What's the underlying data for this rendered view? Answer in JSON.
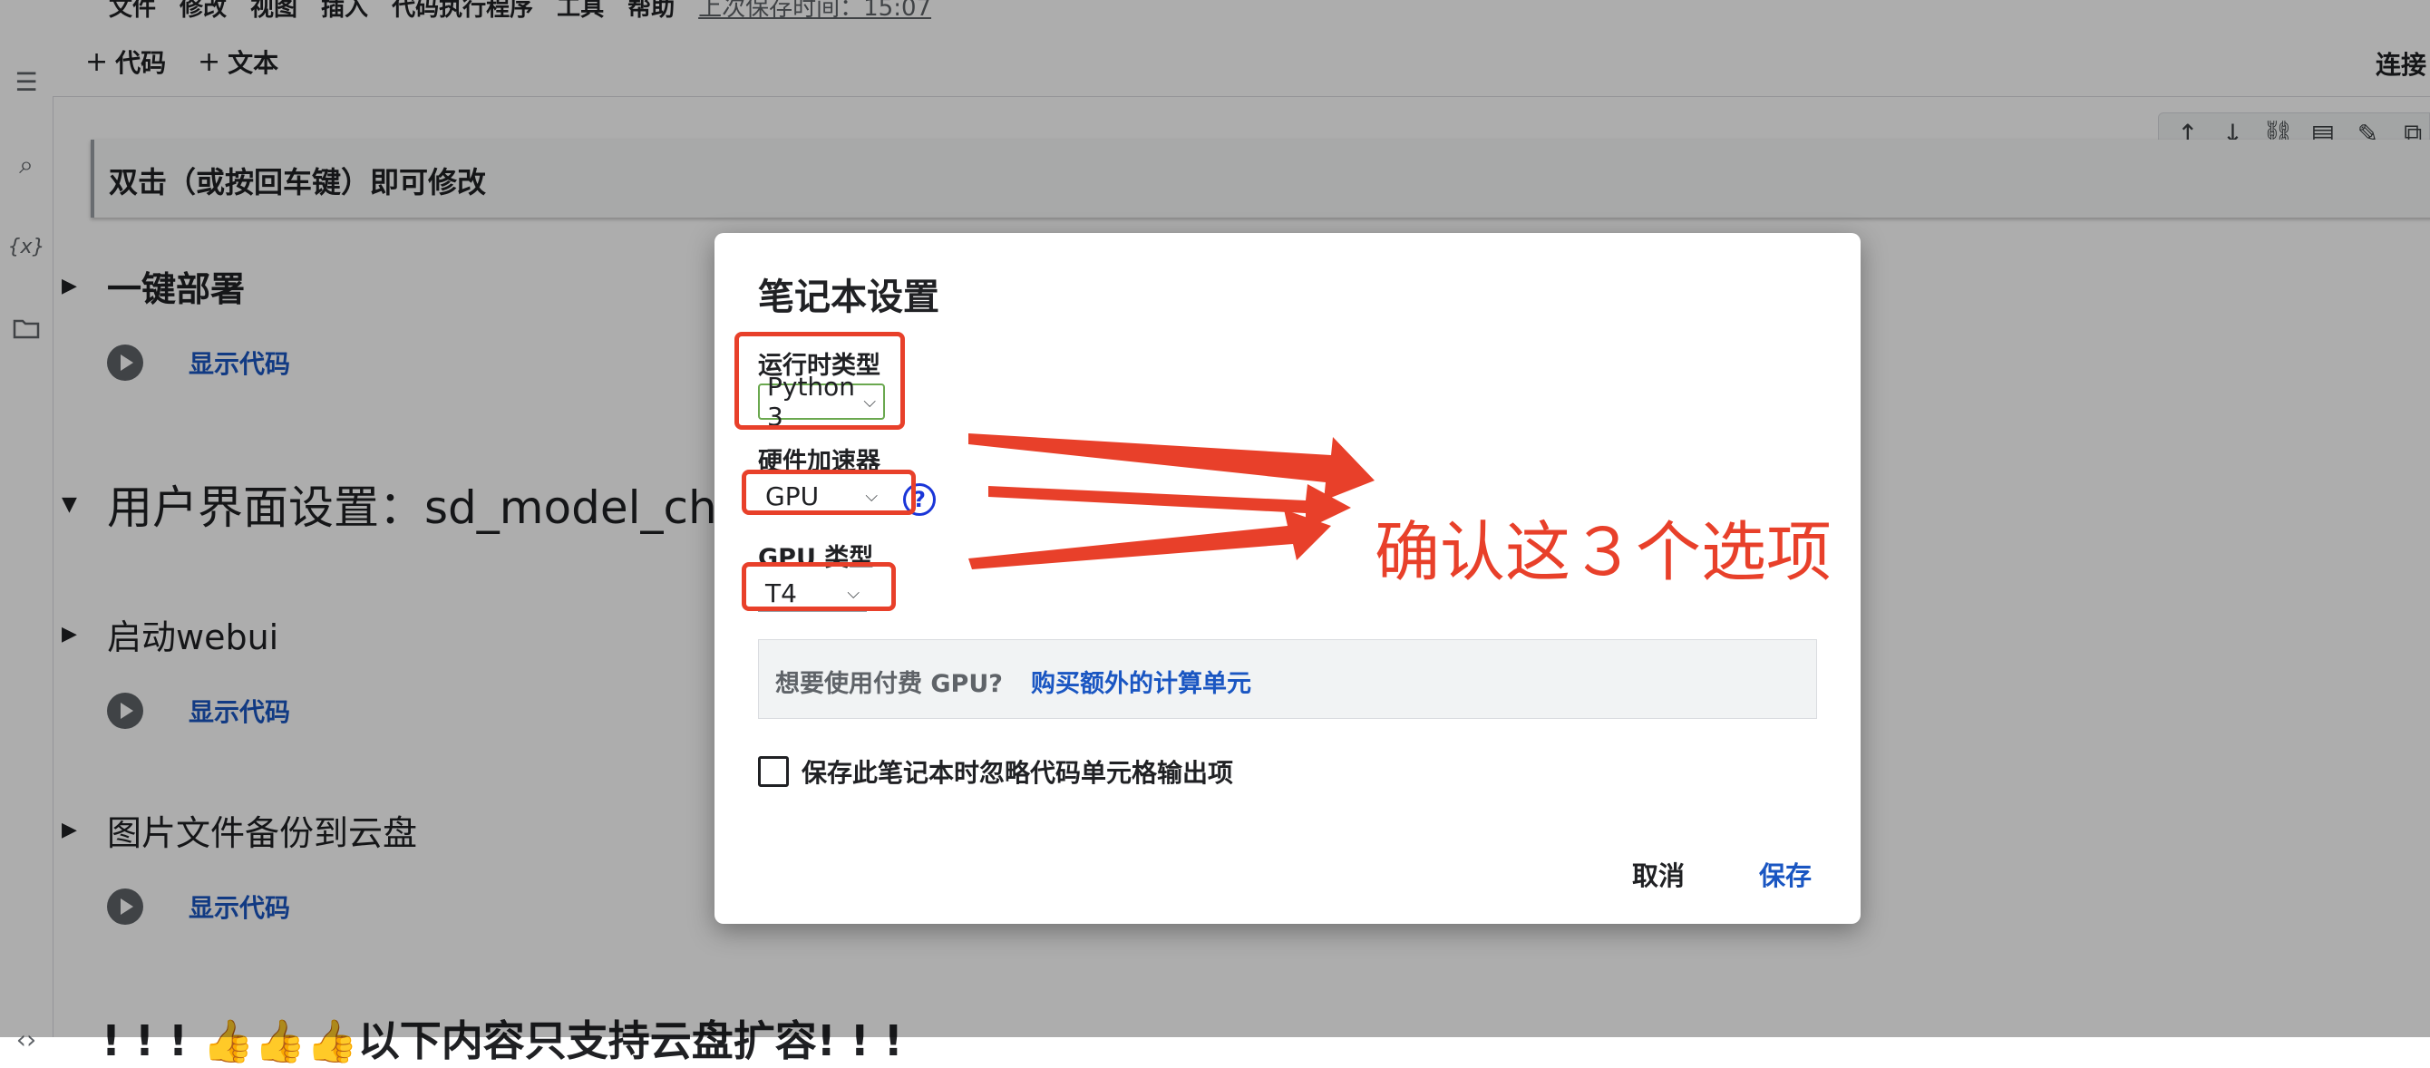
{
  "menu": {
    "items": [
      "文件",
      "修改",
      "视图",
      "插入",
      "代码执行程序",
      "工具",
      "帮助"
    ],
    "last_saved": "上次保存时间：15:07"
  },
  "toolbar": {
    "add_code": "代码",
    "add_text": "文本",
    "connect": "连接"
  },
  "rail_icons": [
    "list-icon",
    "search-icon",
    "variables-icon",
    "folder-icon",
    "code-icon"
  ],
  "cell_tools_icons": [
    "arrow-up-icon",
    "arrow-down-icon",
    "link-icon",
    "comment-icon",
    "edit-icon",
    "mirror-icon"
  ],
  "notebook": {
    "edit_hint": "双击（或按回车键）即可修改",
    "sections": [
      {
        "title": "一键部署",
        "show_code": "显示代码"
      },
      {
        "title": "用户界面设置：sd_model_che"
      },
      {
        "title": "启动webui",
        "show_code": "显示代码"
      },
      {
        "title": "图片文件备份到云盘",
        "show_code": "显示代码"
      }
    ],
    "bottom_text": "! ! ! 👍👍👍以下内容只支持云盘扩容! ! !"
  },
  "dialog": {
    "title": "笔记本设置",
    "runtime_label": "运行时类型",
    "runtime_value": "Python 3",
    "hardware_label": "硬件加速器",
    "hardware_value": "GPU",
    "help_glyph": "?",
    "gpu_type_label": "GPU 类型",
    "gpu_type_value": "T4",
    "pay_question": "想要使用付费 GPU?",
    "pay_link": "购买额外的计算单元",
    "omit_output_label": "保存此笔记本时忽略代码单元格输出项",
    "omit_output_checked": false,
    "cancel": "取消",
    "save": "保存"
  },
  "annotation": {
    "text": "确认这３个选项",
    "color": "#e8402a"
  }
}
